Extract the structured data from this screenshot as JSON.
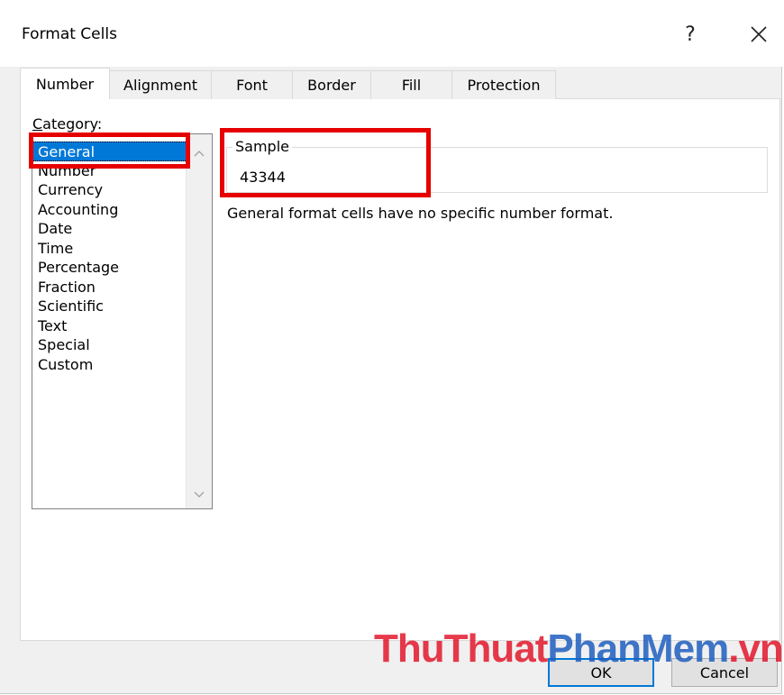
{
  "window": {
    "title": "Format Cells",
    "help": "?",
    "close": "✕"
  },
  "tabs": [
    {
      "label": "Number",
      "active": true
    },
    {
      "label": "Alignment"
    },
    {
      "label": "Font"
    },
    {
      "label": "Border"
    },
    {
      "label": "Fill"
    },
    {
      "label": "Protection"
    }
  ],
  "category": {
    "label_prefix": "C",
    "label_rest": "ategory:",
    "items": [
      "General",
      "Number",
      "Currency",
      "Accounting",
      "Date",
      "Time",
      "Percentage",
      "Fraction",
      "Scientific",
      "Text",
      "Special",
      "Custom"
    ],
    "selected": "General"
  },
  "sample": {
    "label": "Sample",
    "value": "43344"
  },
  "description": "General format cells have no specific number format.",
  "buttons": {
    "ok": "OK",
    "cancel": "Cancel"
  },
  "watermark": {
    "part1": "ThuThuat",
    "part2": "PhanMem",
    "part3": ".vn"
  },
  "colors": {
    "selection": "#0078d7",
    "highlight_box": "#e60000"
  }
}
